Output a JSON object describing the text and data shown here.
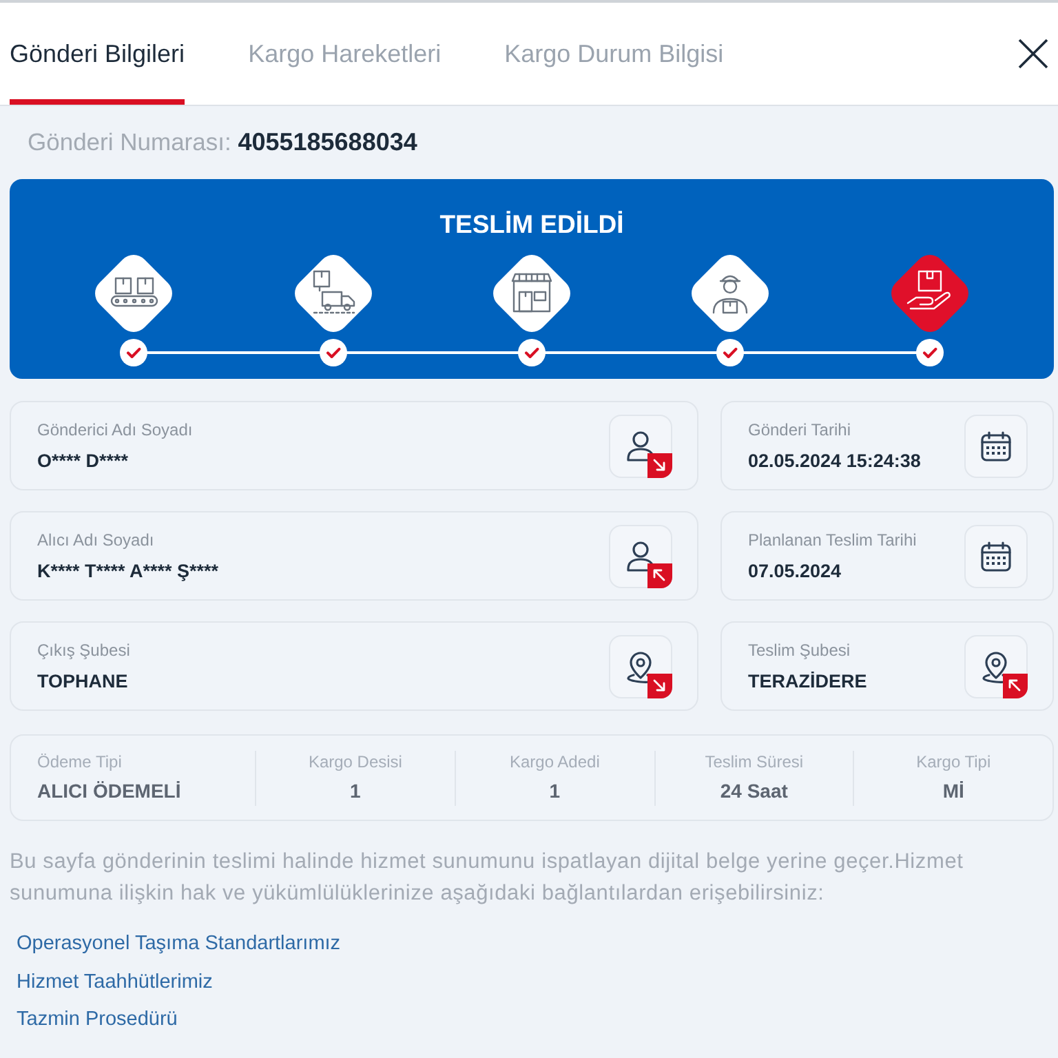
{
  "tabs": [
    {
      "label": "Gönderi Bilgileri",
      "selected": true
    },
    {
      "label": "Kargo Hareketleri",
      "selected": false
    },
    {
      "label": "Kargo Durum Bilgisi",
      "selected": false
    }
  ],
  "shipment_number": {
    "label": "Gönderi Numarası:",
    "value": "4055185688034"
  },
  "status": {
    "title": "TESLİM EDİLDİ",
    "steps": [
      {
        "kind": "conveyor",
        "done": true,
        "current": false
      },
      {
        "kind": "truck",
        "done": true,
        "current": false
      },
      {
        "kind": "store",
        "done": true,
        "current": false
      },
      {
        "kind": "courier",
        "done": true,
        "current": false
      },
      {
        "kind": "hand_box",
        "done": true,
        "current": true
      }
    ]
  },
  "fields": [
    {
      "label": "Gönderici Adı Soyadı",
      "value": "O**** D****",
      "kind": "person",
      "badge": {
        "kind": "outgoing"
      }
    },
    {
      "label": "Gönderi Tarihi",
      "value": "02.05.2024 15:24:38",
      "kind": "calendar"
    },
    {
      "label": "Alıcı Adı Soyadı",
      "value": "K**** T**** A**** Ş****",
      "kind": "person",
      "badge": {
        "kind": "incoming"
      }
    },
    {
      "label": "Planlanan Teslim Tarihi",
      "value": "07.05.2024",
      "kind": "calendar"
    },
    {
      "label": "Çıkış Şubesi",
      "value": "TOPHANE",
      "kind": "location",
      "badge": {
        "kind": "outgoing"
      }
    },
    {
      "label": "Teslim Şubesi",
      "value": "TERAZİDERE",
      "kind": "location",
      "badge": {
        "kind": "incoming"
      }
    }
  ],
  "summary": [
    {
      "label": "Ödeme Tipi",
      "value": "ALICI ÖDEMELİ"
    },
    {
      "label": "Kargo Desisi",
      "value": "1"
    },
    {
      "label": "Kargo Adedi",
      "value": "1"
    },
    {
      "label": "Teslim Süresi",
      "value": "24 Saat"
    },
    {
      "label": "Kargo Tipi",
      "value": "Mİ"
    }
  ],
  "notice": "Bu sayfa gönderinin teslimi halinde hizmet sunumunu ispatlayan dijital belge yerine geçer.Hizmet sunumuna ilişkin hak ve yükümlülüklerinize aşağıdaki bağlantılardan erişebilirsiniz:",
  "links": [
    "Operasyonel Taşıma Standartlarımız",
    "Hizmet Taahhütlerimiz",
    "Tazmin Prosedürü"
  ]
}
